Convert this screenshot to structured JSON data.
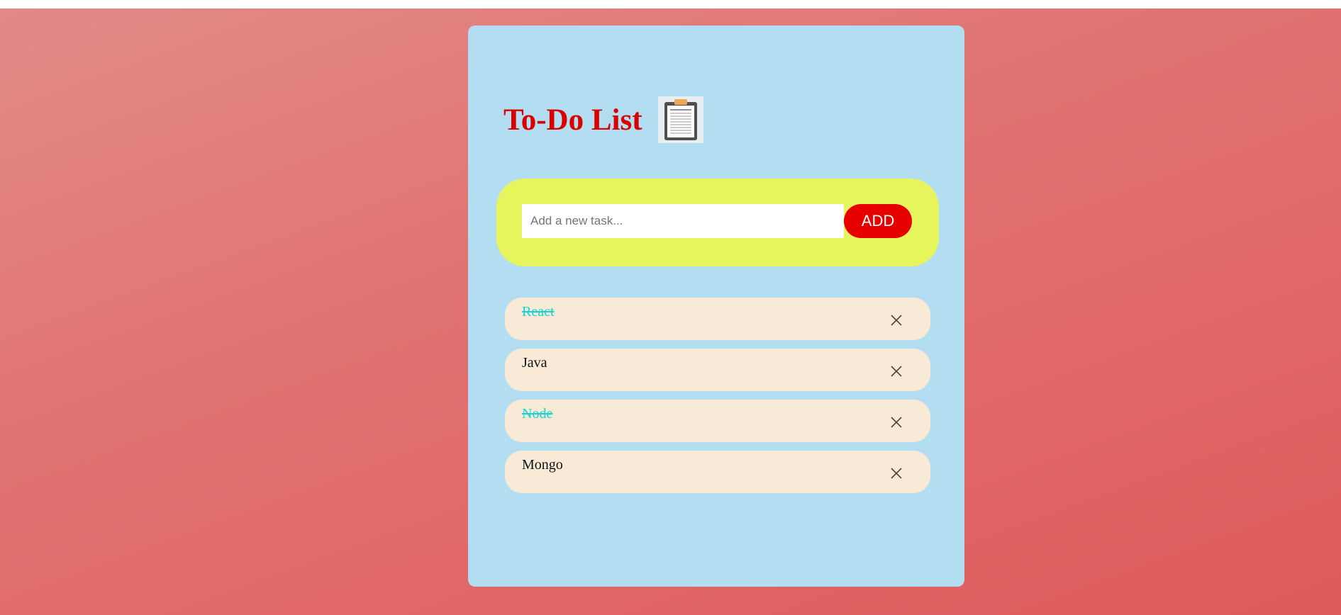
{
  "app": {
    "title": "To-Do List",
    "icon": "clipboard-icon"
  },
  "form": {
    "placeholder": "Add a new task...",
    "value": "",
    "add_label": "ADD"
  },
  "tasks": [
    {
      "text": "React",
      "done": true
    },
    {
      "text": "Java",
      "done": false
    },
    {
      "text": "Node",
      "done": true
    },
    {
      "text": "Mongo",
      "done": false
    }
  ],
  "colors": {
    "title": "#d90000",
    "card_background": "#b3ddf0",
    "input_panel": "#e6f55c",
    "add_button": "#e60000",
    "task_background": "#f8ead6",
    "done_text": "#16d4d4"
  }
}
